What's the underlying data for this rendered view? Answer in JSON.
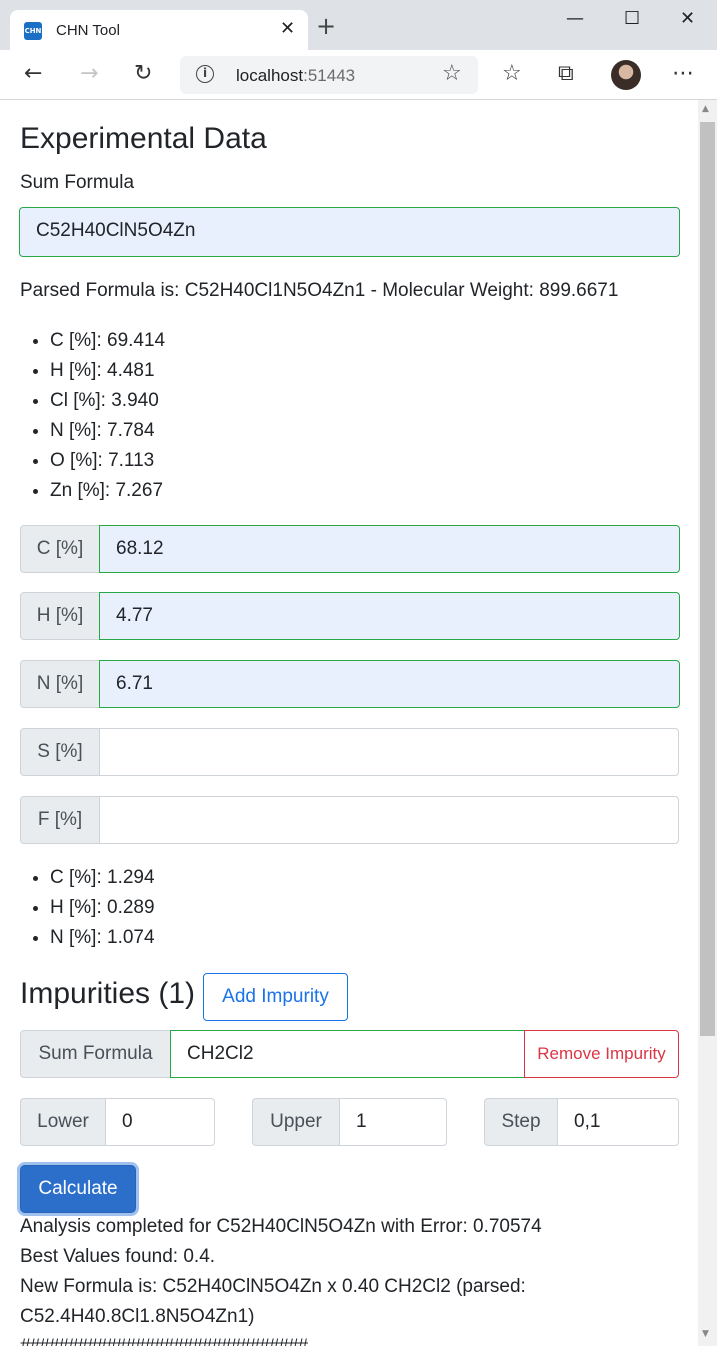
{
  "browser": {
    "tab_title": "CHN Tool",
    "favicon_text": "CHN",
    "address_host": "localhost",
    "address_port": ":51443"
  },
  "experimental": {
    "heading": "Experimental Data",
    "sum_formula_label": "Sum Formula",
    "sum_formula_value": "C52H40ClN5O4Zn",
    "parsed_text": "Parsed Formula is: C52H40Cl1N5O4Zn1 - Molecular Weight: 899.6671",
    "calculated": [
      "C [%]: 69.414",
      "H [%]: 4.481",
      "Cl [%]: 3.940",
      "N [%]: 7.784",
      "O [%]: 7.113",
      "Zn [%]: 7.267"
    ],
    "inputs": [
      {
        "label": "C [%]",
        "value": "68.12"
      },
      {
        "label": "H [%]",
        "value": "4.77"
      },
      {
        "label": "N [%]",
        "value": "6.71"
      },
      {
        "label": "S [%]",
        "value": ""
      },
      {
        "label": "F [%]",
        "value": ""
      }
    ],
    "deviations": [
      "C [%]: 1.294",
      "H [%]: 0.289",
      "N [%]: 1.074"
    ]
  },
  "impurities": {
    "heading": "Impurities (1)",
    "add_button": "Add Impurity",
    "sum_formula_label": "Sum Formula",
    "sum_formula_value": "CH2Cl2",
    "remove_button": "Remove Impurity",
    "lower_label": "Lower",
    "lower_value": "0",
    "upper_label": "Upper",
    "upper_value": "1",
    "step_label": "Step",
    "step_value": "0,1"
  },
  "calculate_button": "Calculate",
  "results": {
    "line1": "Analysis completed for C52H40ClN5O4Zn with Error: 0.70574",
    "line2": "Best Values found: 0.4.",
    "line3": "New Formula is: C52H40ClN5O4Zn x 0.40 CH2Cl2 (parsed:",
    "line4": "C52.4H40.8Cl1.8N5O4Zn1)",
    "line5": "##############################"
  },
  "colors": {
    "valid_border": "#28a745",
    "autofill_bg": "#e8f0fe",
    "primary": "#2c6fcb",
    "danger": "#dc3545"
  }
}
